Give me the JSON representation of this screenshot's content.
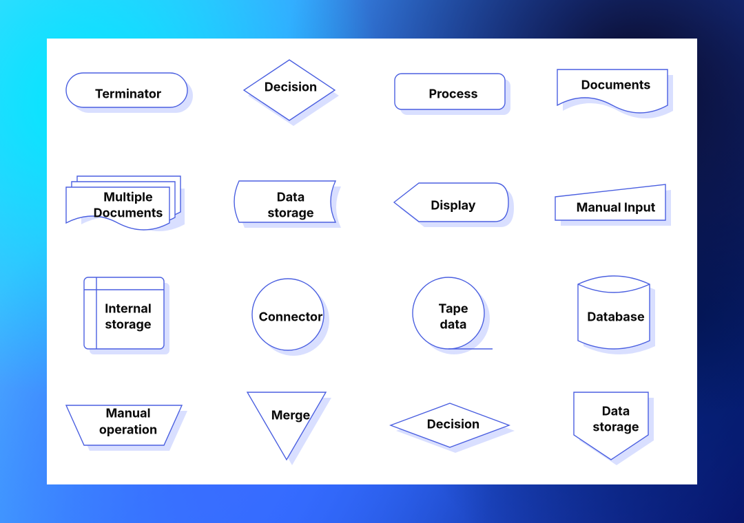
{
  "shapes": {
    "terminator": {
      "label": "Terminator"
    },
    "decision": {
      "label": "Decision"
    },
    "process": {
      "label": "Process"
    },
    "documents": {
      "label": "Documents"
    },
    "multiple_documents": {
      "label": "Multiple\nDocuments"
    },
    "data_storage": {
      "label": "Data\nstorage"
    },
    "display": {
      "label": "Display"
    },
    "manual_input": {
      "label": "Manual Input"
    },
    "internal_storage": {
      "label": "Internal\nstorage"
    },
    "connector": {
      "label": "Connector"
    },
    "tape_data": {
      "label": "Tape\ndata"
    },
    "database": {
      "label": "Database"
    },
    "manual_operation": {
      "label": "Manual\noperation"
    },
    "merge": {
      "label": "Merge"
    },
    "decision_flat": {
      "label": "Decision"
    },
    "data_storage_arrow": {
      "label": "Data\nstorage"
    }
  },
  "palette": {
    "stroke": "#4a5fe0",
    "shadow": "#b9c4ff"
  }
}
